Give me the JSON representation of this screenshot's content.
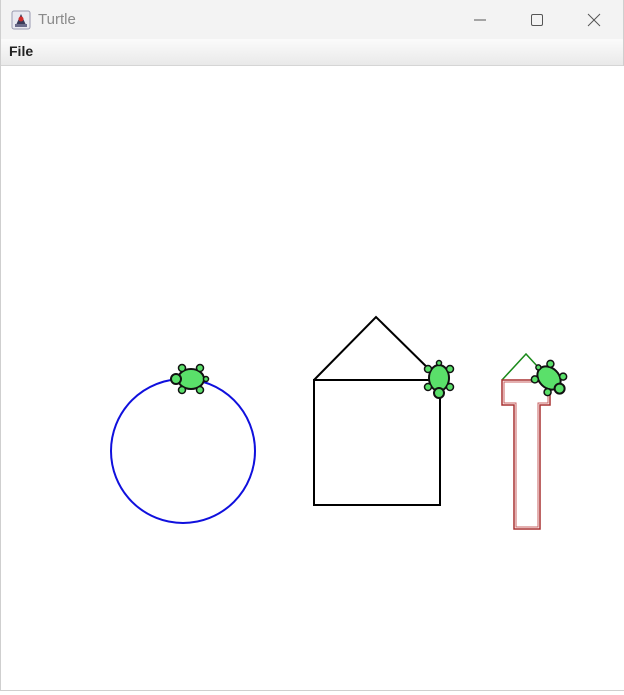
{
  "window": {
    "title": "Turtle",
    "icon": "java-duke-icon",
    "controls": {
      "minimize_icon": "minimize-icon",
      "maximize_icon": "maximize-icon",
      "close_icon": "close-icon"
    }
  },
  "menubar": {
    "items": [
      {
        "label": "File"
      }
    ]
  },
  "drawing": {
    "background": "#ffffff",
    "turtle_color": "#5ae06a",
    "shapes": [
      {
        "name": "circle",
        "stroke": "#1010dd"
      },
      {
        "name": "house",
        "stroke": "#000000"
      },
      {
        "name": "roof-small",
        "stroke": "#1a8a1a"
      },
      {
        "name": "t-shape",
        "stroke": "#a83232"
      }
    ]
  }
}
